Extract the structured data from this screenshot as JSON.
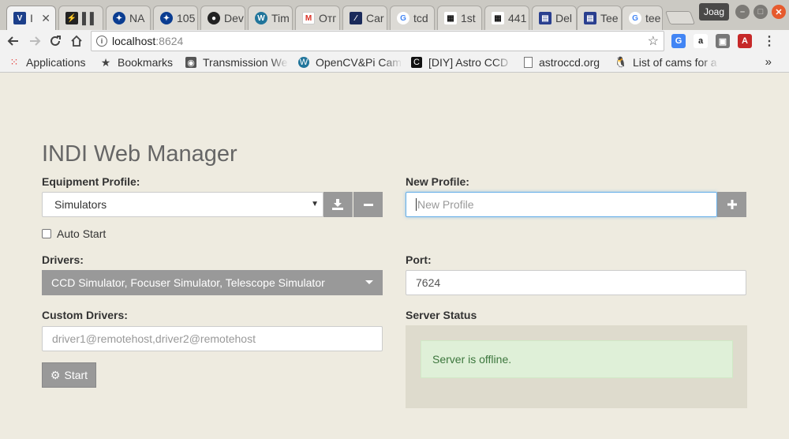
{
  "browser": {
    "tabs": [
      {
        "label": "I",
        "icon": "indi-icon",
        "active": true
      },
      {
        "label": "▌▌",
        "icon": "bolt-icon"
      },
      {
        "label": "NA",
        "icon": "nasa-icon"
      },
      {
        "label": "105",
        "icon": "nasa-icon"
      },
      {
        "label": "Dev",
        "icon": "github-icon"
      },
      {
        "label": "Tim",
        "icon": "wordpress-icon"
      },
      {
        "label": "Отг",
        "icon": "gmail-icon"
      },
      {
        "label": "Car",
        "icon": "app-icon"
      },
      {
        "label": "tcd",
        "icon": "google-icon"
      },
      {
        "label": "1st",
        "icon": "qr-icon"
      },
      {
        "label": "441",
        "icon": "qr-icon"
      },
      {
        "label": "Del",
        "icon": "calendar-icon"
      },
      {
        "label": "Tee",
        "icon": "calendar-icon"
      },
      {
        "label": "tee",
        "icon": "google-icon"
      }
    ],
    "profile_name": "Joag",
    "address": {
      "host": "localhost",
      "port": ":8624"
    },
    "bookmarks": [
      {
        "label": "Applications",
        "icon": "apps-grid-icon"
      },
      {
        "label": "Bookmarks",
        "icon": "star-icon"
      },
      {
        "label": "Transmission We",
        "icon": "transmission-icon"
      },
      {
        "label": "OpenCV&Pi Cam",
        "icon": "wordpress-icon"
      },
      {
        "label": "[DIY] Astro CCD",
        "icon": "c-logo-icon"
      },
      {
        "label": "astroccd.org",
        "icon": "document-icon"
      },
      {
        "label": "List of cams for a",
        "icon": "penguin-icon"
      }
    ],
    "bookmarks_more": "»",
    "colors": {
      "tab_strip": "#cbc9c3",
      "toolbar": "#f2f2f2",
      "close_button": "#e65a2d"
    }
  },
  "page": {
    "title": "INDI Web Manager",
    "equipment_profile": {
      "label": "Equipment Profile:",
      "selected": "Simulators"
    },
    "auto_start": {
      "label": "Auto Start",
      "checked": false
    },
    "new_profile": {
      "label": "New Profile:",
      "placeholder": "New Profile"
    },
    "drivers": {
      "label": "Drivers:",
      "selected": "CCD Simulator, Focuser Simulator, Telescope Simulator"
    },
    "port": {
      "label": "Port:",
      "value": "7624"
    },
    "custom_drivers": {
      "label": "Custom Drivers:",
      "placeholder": "driver1@remotehost,driver2@remotehost"
    },
    "start_button": "Start",
    "server_status": {
      "label": "Server Status",
      "message": "Server is offline."
    },
    "colors": {
      "background": "#eeebe0",
      "button_gray": "#999999",
      "status_panel": "#dedbcd",
      "alert_bg": "#dff0d8",
      "alert_text": "#3c763d"
    }
  }
}
